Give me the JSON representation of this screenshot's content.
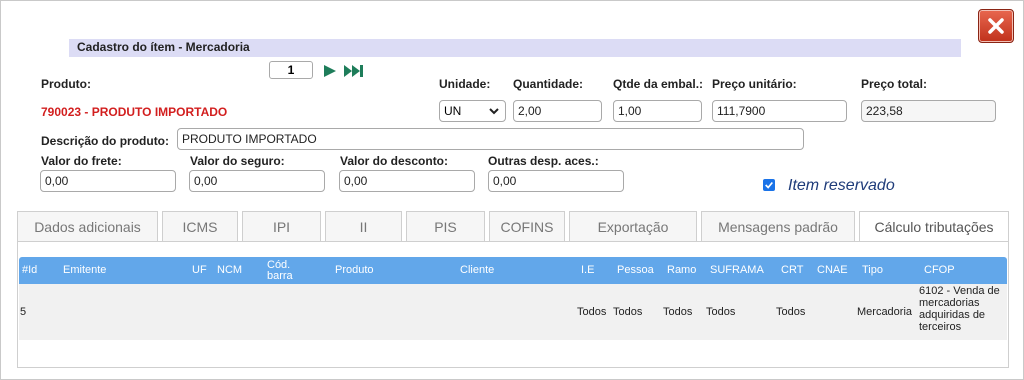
{
  "dialog": {
    "title": "Cadastro do ítem - Mercadoria"
  },
  "nav": {
    "page": "1"
  },
  "product": {
    "label": "Produto:",
    "code": "790023 - PRODUTO IMPORTADO"
  },
  "fields": {
    "unidade_label": "Unidade:",
    "unidade_value": "UN",
    "quantidade_label": "Quantidade:",
    "quantidade_value": "2,00",
    "qtde_embal_label": "Qtde da embal.:",
    "qtde_embal_value": "1,00",
    "preco_unit_label": "Preço unitário:",
    "preco_unit_value": "111,7900",
    "preco_total_label": "Preço total:",
    "preco_total_value": "223,58",
    "descricao_label": "Descrição do produto:",
    "descricao_value": "PRODUTO IMPORTADO",
    "frete_label": "Valor do frete:",
    "frete_value": "0,00",
    "seguro_label": "Valor do seguro:",
    "seguro_value": "0,00",
    "desconto_label": "Valor do desconto:",
    "desconto_value": "0,00",
    "outras_label": "Outras desp. aces.:",
    "outras_value": "0,00",
    "item_reservado_label": "Item reservado",
    "item_reservado_checked": true
  },
  "tabs": [
    {
      "label": "Dados adicionais"
    },
    {
      "label": "ICMS"
    },
    {
      "label": "IPI"
    },
    {
      "label": "II"
    },
    {
      "label": "PIS"
    },
    {
      "label": "COFINS"
    },
    {
      "label": "Exportação"
    },
    {
      "label": "Mensagens padrão"
    },
    {
      "label": "Cálculo tributações",
      "active": true
    }
  ],
  "table": {
    "headers": {
      "id": "#Id",
      "emitente": "Emitente",
      "uf": "UF",
      "ncm": "NCM",
      "cod_barra": "Cód. barra",
      "produto": "Produto",
      "cliente": "Cliente",
      "ie": "I.E",
      "pessoa": "Pessoa",
      "ramo": "Ramo",
      "suframa": "SUFRAMA",
      "crt": "CRT",
      "cnae": "CNAE",
      "tipo": "Tipo",
      "cfop": "CFOP"
    },
    "rows": [
      {
        "id": "5",
        "ie": "Todos",
        "pessoa": "Todos",
        "ramo": "Todos",
        "suframa": "Todos",
        "crt": "Todos",
        "tipo": "Mercadoria",
        "cfop": "6102 - Venda de mercadorias adquiridas de terceiros"
      }
    ]
  },
  "colors": {
    "header_bg": "#62a7ea",
    "title_bar_bg": "#dcdcf5",
    "product_code": "#d21e1e",
    "close_button": "#c0311b",
    "nav_arrow": "#1e7d5a"
  }
}
